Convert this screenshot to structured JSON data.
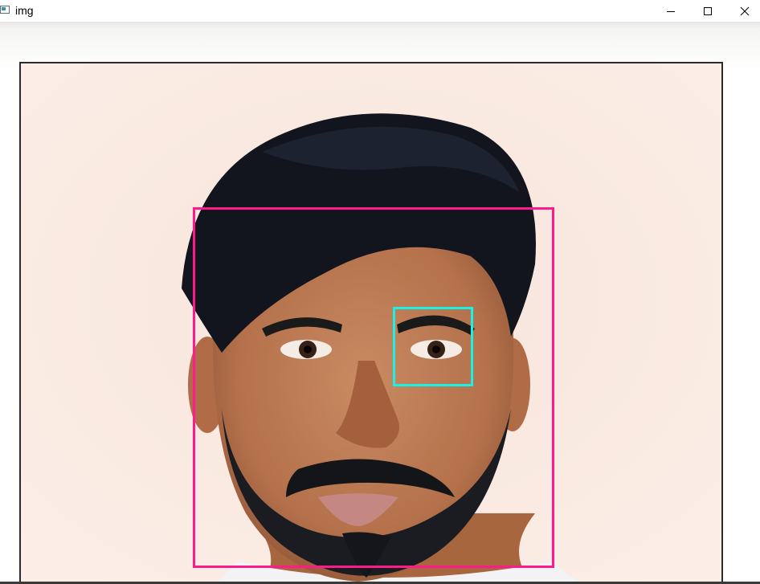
{
  "window": {
    "title": "img",
    "minimize_icon": "minimize-icon",
    "maximize_icon": "maximize-icon",
    "close_icon": "close-icon"
  },
  "image": {
    "subject": "portrait-photo",
    "detections": [
      {
        "label": "face",
        "color": "#ff1a8c"
      },
      {
        "label": "eye",
        "color": "#19f0e6"
      }
    ]
  }
}
